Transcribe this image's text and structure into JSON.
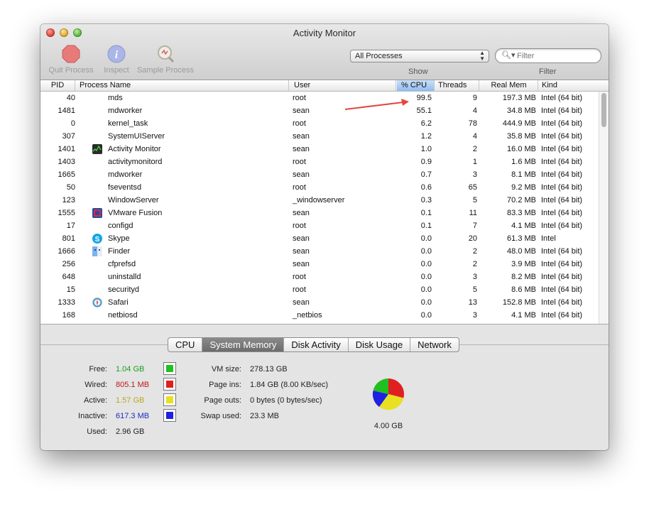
{
  "window": {
    "title": "Activity Monitor"
  },
  "toolbar": {
    "quit": "Quit Process",
    "inspect": "Inspect",
    "sample": "Sample Process",
    "show_label": "Show",
    "filter_label": "Filter",
    "process_filter": "All Processes",
    "search_placeholder": "Filter"
  },
  "table": {
    "headers": {
      "pid": "PID",
      "name": "Process Name",
      "user": "User",
      "cpu": "% CPU",
      "threads": "Threads",
      "mem": "Real Mem",
      "kind": "Kind"
    },
    "rows": [
      {
        "pid": "40",
        "name": "mds",
        "icon": "",
        "user": "root",
        "cpu": "99.5",
        "threads": "9",
        "mem": "197.3 MB",
        "kind": "Intel (64 bit)"
      },
      {
        "pid": "1481",
        "name": "mdworker",
        "icon": "",
        "user": "sean",
        "cpu": "55.1",
        "threads": "4",
        "mem": "34.8 MB",
        "kind": "Intel (64 bit)"
      },
      {
        "pid": "0",
        "name": "kernel_task",
        "icon": "",
        "user": "root",
        "cpu": "6.2",
        "threads": "78",
        "mem": "444.9 MB",
        "kind": "Intel (64 bit)"
      },
      {
        "pid": "307",
        "name": "SystemUIServer",
        "icon": "",
        "user": "sean",
        "cpu": "1.2",
        "threads": "4",
        "mem": "35.8 MB",
        "kind": "Intel (64 bit)"
      },
      {
        "pid": "1401",
        "name": "Activity Monitor",
        "icon": "activity-monitor-icon",
        "user": "sean",
        "cpu": "1.0",
        "threads": "2",
        "mem": "16.0 MB",
        "kind": "Intel (64 bit)"
      },
      {
        "pid": "1403",
        "name": "activitymonitord",
        "icon": "",
        "user": "root",
        "cpu": "0.9",
        "threads": "1",
        "mem": "1.6 MB",
        "kind": "Intel (64 bit)"
      },
      {
        "pid": "1665",
        "name": "mdworker",
        "icon": "",
        "user": "sean",
        "cpu": "0.7",
        "threads": "3",
        "mem": "8.1 MB",
        "kind": "Intel (64 bit)"
      },
      {
        "pid": "50",
        "name": "fseventsd",
        "icon": "",
        "user": "root",
        "cpu": "0.6",
        "threads": "65",
        "mem": "9.2 MB",
        "kind": "Intel (64 bit)"
      },
      {
        "pid": "123",
        "name": "WindowServer",
        "icon": "",
        "user": "_windowserver",
        "cpu": "0.3",
        "threads": "5",
        "mem": "70.2 MB",
        "kind": "Intel (64 bit)"
      },
      {
        "pid": "1555",
        "name": "VMware Fusion",
        "icon": "vmware-icon",
        "user": "sean",
        "cpu": "0.1",
        "threads": "11",
        "mem": "83.3 MB",
        "kind": "Intel (64 bit)"
      },
      {
        "pid": "17",
        "name": "configd",
        "icon": "",
        "user": "root",
        "cpu": "0.1",
        "threads": "7",
        "mem": "4.1 MB",
        "kind": "Intel (64 bit)"
      },
      {
        "pid": "801",
        "name": "Skype",
        "icon": "skype-icon",
        "user": "sean",
        "cpu": "0.0",
        "threads": "20",
        "mem": "61.3 MB",
        "kind": "Intel"
      },
      {
        "pid": "1666",
        "name": "Finder",
        "icon": "finder-icon",
        "user": "sean",
        "cpu": "0.0",
        "threads": "2",
        "mem": "48.0 MB",
        "kind": "Intel (64 bit)"
      },
      {
        "pid": "256",
        "name": "cfprefsd",
        "icon": "",
        "user": "sean",
        "cpu": "0.0",
        "threads": "2",
        "mem": "3.9 MB",
        "kind": "Intel (64 bit)"
      },
      {
        "pid": "648",
        "name": "uninstalld",
        "icon": "",
        "user": "root",
        "cpu": "0.0",
        "threads": "3",
        "mem": "8.2 MB",
        "kind": "Intel (64 bit)"
      },
      {
        "pid": "15",
        "name": "securityd",
        "icon": "",
        "user": "root",
        "cpu": "0.0",
        "threads": "5",
        "mem": "8.6 MB",
        "kind": "Intel (64 bit)"
      },
      {
        "pid": "1333",
        "name": "Safari",
        "icon": "safari-icon",
        "user": "sean",
        "cpu": "0.0",
        "threads": "13",
        "mem": "152.8 MB",
        "kind": "Intel (64 bit)"
      },
      {
        "pid": "168",
        "name": "netbiosd",
        "icon": "",
        "user": "_netbios",
        "cpu": "0.0",
        "threads": "3",
        "mem": "4.1 MB",
        "kind": "Intel (64 bit)"
      }
    ]
  },
  "tabs": [
    "CPU",
    "System Memory",
    "Disk Activity",
    "Disk Usage",
    "Network"
  ],
  "active_tab": "System Memory",
  "memory": {
    "free": {
      "label": "Free:",
      "value": "1.04 GB",
      "color": "#20c020"
    },
    "wired": {
      "label": "Wired:",
      "value": "805.1 MB",
      "color": "#e02020"
    },
    "active": {
      "label": "Active:",
      "value": "1.57 GB",
      "color": "#e8e020"
    },
    "inactive": {
      "label": "Inactive:",
      "value": "617.3 MB",
      "color": "#2020e0"
    },
    "used": {
      "label": "Used:",
      "value": "2.96 GB"
    },
    "vm_size": {
      "label": "VM size:",
      "value": "278.13 GB"
    },
    "page_ins": {
      "label": "Page ins:",
      "value": "1.84 GB (8.00 KB/sec)"
    },
    "page_outs": {
      "label": "Page outs:",
      "value": "0 bytes (0 bytes/sec)"
    },
    "swap_used": {
      "label": "Swap used:",
      "value": "23.3 MB"
    },
    "total": "4.00 GB"
  }
}
